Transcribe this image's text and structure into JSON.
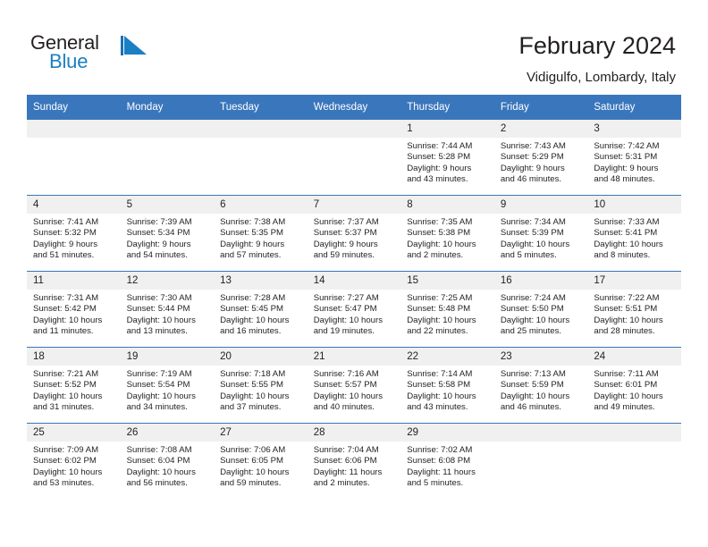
{
  "brand": {
    "name_part1": "General",
    "name_part2": "Blue",
    "logo_icon": "triangle-flag-icon",
    "color_primary": "#1b7fc4",
    "color_text": "#231f20"
  },
  "header": {
    "title": "February 2024",
    "subtitle": "Vidigulfo, Lombardy, Italy"
  },
  "calendar": {
    "header_bg": "#3a76bc",
    "daynum_bg": "#f0f0f0",
    "weekday_headers": [
      "Sunday",
      "Monday",
      "Tuesday",
      "Wednesday",
      "Thursday",
      "Friday",
      "Saturday"
    ],
    "weeks": [
      [
        {
          "day": "",
          "empty": true
        },
        {
          "day": "",
          "empty": true
        },
        {
          "day": "",
          "empty": true
        },
        {
          "day": "",
          "empty": true
        },
        {
          "day": "1",
          "sunrise": "Sunrise: 7:44 AM",
          "sunset": "Sunset: 5:28 PM",
          "daylight1": "Daylight: 9 hours",
          "daylight2": "and 43 minutes."
        },
        {
          "day": "2",
          "sunrise": "Sunrise: 7:43 AM",
          "sunset": "Sunset: 5:29 PM",
          "daylight1": "Daylight: 9 hours",
          "daylight2": "and 46 minutes."
        },
        {
          "day": "3",
          "sunrise": "Sunrise: 7:42 AM",
          "sunset": "Sunset: 5:31 PM",
          "daylight1": "Daylight: 9 hours",
          "daylight2": "and 48 minutes."
        }
      ],
      [
        {
          "day": "4",
          "sunrise": "Sunrise: 7:41 AM",
          "sunset": "Sunset: 5:32 PM",
          "daylight1": "Daylight: 9 hours",
          "daylight2": "and 51 minutes."
        },
        {
          "day": "5",
          "sunrise": "Sunrise: 7:39 AM",
          "sunset": "Sunset: 5:34 PM",
          "daylight1": "Daylight: 9 hours",
          "daylight2": "and 54 minutes."
        },
        {
          "day": "6",
          "sunrise": "Sunrise: 7:38 AM",
          "sunset": "Sunset: 5:35 PM",
          "daylight1": "Daylight: 9 hours",
          "daylight2": "and 57 minutes."
        },
        {
          "day": "7",
          "sunrise": "Sunrise: 7:37 AM",
          "sunset": "Sunset: 5:37 PM",
          "daylight1": "Daylight: 9 hours",
          "daylight2": "and 59 minutes."
        },
        {
          "day": "8",
          "sunrise": "Sunrise: 7:35 AM",
          "sunset": "Sunset: 5:38 PM",
          "daylight1": "Daylight: 10 hours",
          "daylight2": "and 2 minutes."
        },
        {
          "day": "9",
          "sunrise": "Sunrise: 7:34 AM",
          "sunset": "Sunset: 5:39 PM",
          "daylight1": "Daylight: 10 hours",
          "daylight2": "and 5 minutes."
        },
        {
          "day": "10",
          "sunrise": "Sunrise: 7:33 AM",
          "sunset": "Sunset: 5:41 PM",
          "daylight1": "Daylight: 10 hours",
          "daylight2": "and 8 minutes."
        }
      ],
      [
        {
          "day": "11",
          "sunrise": "Sunrise: 7:31 AM",
          "sunset": "Sunset: 5:42 PM",
          "daylight1": "Daylight: 10 hours",
          "daylight2": "and 11 minutes."
        },
        {
          "day": "12",
          "sunrise": "Sunrise: 7:30 AM",
          "sunset": "Sunset: 5:44 PM",
          "daylight1": "Daylight: 10 hours",
          "daylight2": "and 13 minutes."
        },
        {
          "day": "13",
          "sunrise": "Sunrise: 7:28 AM",
          "sunset": "Sunset: 5:45 PM",
          "daylight1": "Daylight: 10 hours",
          "daylight2": "and 16 minutes."
        },
        {
          "day": "14",
          "sunrise": "Sunrise: 7:27 AM",
          "sunset": "Sunset: 5:47 PM",
          "daylight1": "Daylight: 10 hours",
          "daylight2": "and 19 minutes."
        },
        {
          "day": "15",
          "sunrise": "Sunrise: 7:25 AM",
          "sunset": "Sunset: 5:48 PM",
          "daylight1": "Daylight: 10 hours",
          "daylight2": "and 22 minutes."
        },
        {
          "day": "16",
          "sunrise": "Sunrise: 7:24 AM",
          "sunset": "Sunset: 5:50 PM",
          "daylight1": "Daylight: 10 hours",
          "daylight2": "and 25 minutes."
        },
        {
          "day": "17",
          "sunrise": "Sunrise: 7:22 AM",
          "sunset": "Sunset: 5:51 PM",
          "daylight1": "Daylight: 10 hours",
          "daylight2": "and 28 minutes."
        }
      ],
      [
        {
          "day": "18",
          "sunrise": "Sunrise: 7:21 AM",
          "sunset": "Sunset: 5:52 PM",
          "daylight1": "Daylight: 10 hours",
          "daylight2": "and 31 minutes."
        },
        {
          "day": "19",
          "sunrise": "Sunrise: 7:19 AM",
          "sunset": "Sunset: 5:54 PM",
          "daylight1": "Daylight: 10 hours",
          "daylight2": "and 34 minutes."
        },
        {
          "day": "20",
          "sunrise": "Sunrise: 7:18 AM",
          "sunset": "Sunset: 5:55 PM",
          "daylight1": "Daylight: 10 hours",
          "daylight2": "and 37 minutes."
        },
        {
          "day": "21",
          "sunrise": "Sunrise: 7:16 AM",
          "sunset": "Sunset: 5:57 PM",
          "daylight1": "Daylight: 10 hours",
          "daylight2": "and 40 minutes."
        },
        {
          "day": "22",
          "sunrise": "Sunrise: 7:14 AM",
          "sunset": "Sunset: 5:58 PM",
          "daylight1": "Daylight: 10 hours",
          "daylight2": "and 43 minutes."
        },
        {
          "day": "23",
          "sunrise": "Sunrise: 7:13 AM",
          "sunset": "Sunset: 5:59 PM",
          "daylight1": "Daylight: 10 hours",
          "daylight2": "and 46 minutes."
        },
        {
          "day": "24",
          "sunrise": "Sunrise: 7:11 AM",
          "sunset": "Sunset: 6:01 PM",
          "daylight1": "Daylight: 10 hours",
          "daylight2": "and 49 minutes."
        }
      ],
      [
        {
          "day": "25",
          "sunrise": "Sunrise: 7:09 AM",
          "sunset": "Sunset: 6:02 PM",
          "daylight1": "Daylight: 10 hours",
          "daylight2": "and 53 minutes."
        },
        {
          "day": "26",
          "sunrise": "Sunrise: 7:08 AM",
          "sunset": "Sunset: 6:04 PM",
          "daylight1": "Daylight: 10 hours",
          "daylight2": "and 56 minutes."
        },
        {
          "day": "27",
          "sunrise": "Sunrise: 7:06 AM",
          "sunset": "Sunset: 6:05 PM",
          "daylight1": "Daylight: 10 hours",
          "daylight2": "and 59 minutes."
        },
        {
          "day": "28",
          "sunrise": "Sunrise: 7:04 AM",
          "sunset": "Sunset: 6:06 PM",
          "daylight1": "Daylight: 11 hours",
          "daylight2": "and 2 minutes."
        },
        {
          "day": "29",
          "sunrise": "Sunrise: 7:02 AM",
          "sunset": "Sunset: 6:08 PM",
          "daylight1": "Daylight: 11 hours",
          "daylight2": "and 5 minutes."
        },
        {
          "day": "",
          "empty": true
        },
        {
          "day": "",
          "empty": true
        }
      ]
    ]
  }
}
